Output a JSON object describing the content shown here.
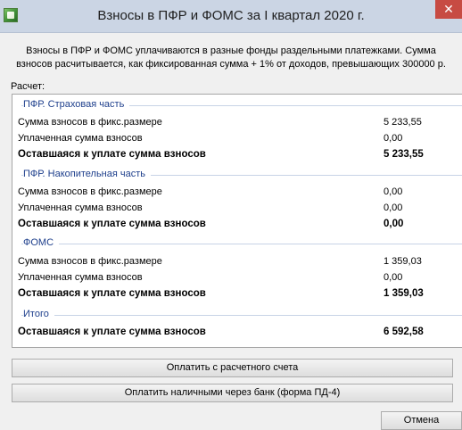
{
  "window": {
    "title": "Взносы в ПФР и ФОМС за I квартал 2020 г.",
    "close_glyph": "✕"
  },
  "description": {
    "line1": "Взносы в ПФР и ФОМС уплачиваются в разные фонды раздельными платежками. Сумма",
    "line2": "взносов расчитывается, как фиксированная сумма + 1% от доходов, превышающих 300000 р."
  },
  "calc_label": "Расчет:",
  "sections": {
    "pfr_insurance": {
      "title": "ПФР. Страховая часть",
      "fixed_label": "Сумма взносов в фикс.размере",
      "fixed_value": "5 233,55",
      "paid_label": "Уплаченная сумма взносов",
      "paid_value": "0,00",
      "remain_label": "Оставшаяся к уплате сумма взносов",
      "remain_value": "5 233,55"
    },
    "pfr_funded": {
      "title": "ПФР. Накопительная часть",
      "fixed_label": "Сумма взносов в фикс.размере",
      "fixed_value": "0,00",
      "paid_label": "Уплаченная сумма взносов",
      "paid_value": "0,00",
      "remain_label": "Оставшаяся к уплате сумма взносов",
      "remain_value": "0,00"
    },
    "foms": {
      "title": "ФОМС",
      "fixed_label": "Сумма взносов в фикс.размере",
      "fixed_value": "1 359,03",
      "paid_label": "Уплаченная сумма взносов",
      "paid_value": "0,00",
      "remain_label": "Оставшаяся к уплате сумма взносов",
      "remain_value": "1 359,03"
    },
    "total": {
      "title": "Итого",
      "remain_label": "Оставшаяся к уплате сумма взносов",
      "remain_value": "6 592,58"
    }
  },
  "buttons": {
    "pay_account": "Оплатить с расчетного счета",
    "pay_cash": "Оплатить наличными через банк (форма ПД-4)",
    "cancel": "Отмена"
  }
}
